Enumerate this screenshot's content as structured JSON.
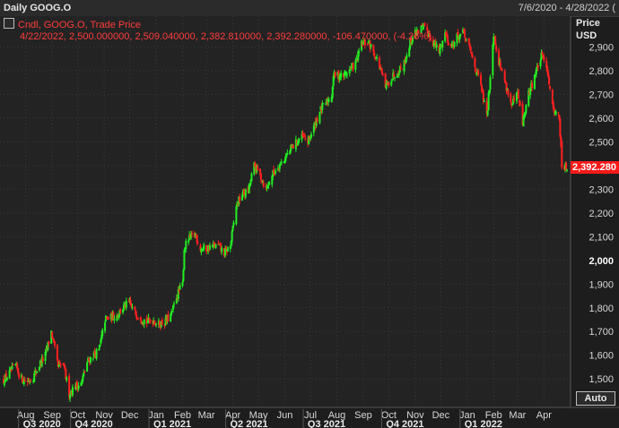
{
  "header": {
    "title": "Daily GOOG.O",
    "range": "7/6/2020 - 4/28/2022 ("
  },
  "legend": {
    "line1": "Cndl, GOOG.O, Trade Price",
    "line2": "4/22/2022, 2,500.000000, 2,509.040000, 2,382.810000, 2,392.280000, -106.470000, (-4.26%)"
  },
  "axis_head": {
    "line1": "Price",
    "line2": "USD"
  },
  "last_price_label": "2,392.280",
  "auto_button": "Auto",
  "colors": {
    "up": "#22ee22",
    "down": "#ff2020",
    "grid": "#3a3a3a",
    "background": "#232323"
  },
  "chart_data": {
    "type": "candlestick",
    "title": "Daily GOOG.O",
    "ylabel": "Price USD",
    "ylim": [
      1380,
      3030
    ],
    "grid": true,
    "y_ticks": [
      1500,
      1600,
      1700,
      1800,
      1900,
      2000,
      2100,
      2200,
      2300,
      2400,
      2500,
      2600,
      2700,
      2800,
      2900
    ],
    "y_tick_labels": [
      "1,500",
      "1,600",
      "1,700",
      "1,800",
      "1,900",
      "2,000",
      "2,100",
      "2,200",
      "2,300",
      "2,400",
      "2,500",
      "2,600",
      "2,700",
      "2,800",
      "2,900"
    ],
    "x_ticks": [
      {
        "label": "Aug",
        "date": "2020-08-01"
      },
      {
        "label": "Sep",
        "date": "2020-09-01"
      },
      {
        "label": "Oct",
        "date": "2020-10-01"
      },
      {
        "label": "Nov",
        "date": "2020-11-01"
      },
      {
        "label": "Dec",
        "date": "2020-12-01"
      },
      {
        "label": "Jan",
        "date": "2021-01-01"
      },
      {
        "label": "Feb",
        "date": "2021-02-01"
      },
      {
        "label": "Mar",
        "date": "2021-03-01"
      },
      {
        "label": "Apr",
        "date": "2021-04-01"
      },
      {
        "label": "May",
        "date": "2021-05-01"
      },
      {
        "label": "Jun",
        "date": "2021-06-01"
      },
      {
        "label": "Jul",
        "date": "2021-07-01"
      },
      {
        "label": "Aug",
        "date": "2021-08-01"
      },
      {
        "label": "Sep",
        "date": "2021-09-01"
      },
      {
        "label": "Oct",
        "date": "2021-10-01"
      },
      {
        "label": "Nov",
        "date": "2021-11-01"
      },
      {
        "label": "Dec",
        "date": "2021-12-01"
      },
      {
        "label": "Jan",
        "date": "2022-01-01"
      },
      {
        "label": "Feb",
        "date": "2022-02-01"
      },
      {
        "label": "Mar",
        "date": "2022-03-01"
      },
      {
        "label": "Apr",
        "date": "2022-04-01"
      }
    ],
    "x_groups": [
      {
        "label": "Q3 2020",
        "date": "2020-08-01"
      },
      {
        "label": "Q4 2020",
        "date": "2020-10-01"
      },
      {
        "label": "Q1 2021",
        "date": "2021-01-01"
      },
      {
        "label": "Q2 2021",
        "date": "2021-04-01"
      },
      {
        "label": "Q3 2021",
        "date": "2021-07-01"
      },
      {
        "label": "Q4 2021",
        "date": "2021-10-01"
      },
      {
        "label": "Q1 2022",
        "date": "2022-01-01"
      }
    ],
    "x_range": [
      "2020-07-06",
      "2022-04-28"
    ],
    "close_path": [
      [
        "2020-07-06",
        1495
      ],
      [
        "2020-07-13",
        1525
      ],
      [
        "2020-07-20",
        1555
      ],
      [
        "2020-07-27",
        1500
      ],
      [
        "2020-08-03",
        1490
      ],
      [
        "2020-08-10",
        1510
      ],
      [
        "2020-08-17",
        1560
      ],
      [
        "2020-08-24",
        1600
      ],
      [
        "2020-08-31",
        1700
      ],
      [
        "2020-09-03",
        1640
      ],
      [
        "2020-09-08",
        1550
      ],
      [
        "2020-09-14",
        1560
      ],
      [
        "2020-09-21",
        1440
      ],
      [
        "2020-09-28",
        1470
      ],
      [
        "2020-10-05",
        1480
      ],
      [
        "2020-10-12",
        1570
      ],
      [
        "2020-10-19",
        1600
      ],
      [
        "2020-10-26",
        1620
      ],
      [
        "2020-11-02",
        1750
      ],
      [
        "2020-11-09",
        1760
      ],
      [
        "2020-11-16",
        1770
      ],
      [
        "2020-11-23",
        1800
      ],
      [
        "2020-11-30",
        1820
      ],
      [
        "2020-12-07",
        1780
      ],
      [
        "2020-12-14",
        1760
      ],
      [
        "2020-12-21",
        1740
      ],
      [
        "2020-12-28",
        1750
      ],
      [
        "2021-01-04",
        1730
      ],
      [
        "2021-01-11",
        1740
      ],
      [
        "2021-01-19",
        1770
      ],
      [
        "2021-01-25",
        1850
      ],
      [
        "2021-02-01",
        1900
      ],
      [
        "2021-02-03",
        2050
      ],
      [
        "2021-02-08",
        2090
      ],
      [
        "2021-02-16",
        2110
      ],
      [
        "2021-02-22",
        2050
      ],
      [
        "2021-03-01",
        2050
      ],
      [
        "2021-03-08",
        2060
      ],
      [
        "2021-03-15",
        2060
      ],
      [
        "2021-03-22",
        2030
      ],
      [
        "2021-03-29",
        2060
      ],
      [
        "2021-04-05",
        2230
      ],
      [
        "2021-04-12",
        2280
      ],
      [
        "2021-04-19",
        2290
      ],
      [
        "2021-04-26",
        2400
      ],
      [
        "2021-05-03",
        2360
      ],
      [
        "2021-05-10",
        2300
      ],
      [
        "2021-05-17",
        2360
      ],
      [
        "2021-05-24",
        2400
      ],
      [
        "2021-06-01",
        2430
      ],
      [
        "2021-06-08",
        2470
      ],
      [
        "2021-06-15",
        2500
      ],
      [
        "2021-06-22",
        2520
      ],
      [
        "2021-06-28",
        2500
      ],
      [
        "2021-07-06",
        2570
      ],
      [
        "2021-07-12",
        2630
      ],
      [
        "2021-07-19",
        2660
      ],
      [
        "2021-07-26",
        2700
      ],
      [
        "2021-07-28",
        2780
      ],
      [
        "2021-08-09",
        2780
      ],
      [
        "2021-08-23",
        2830
      ],
      [
        "2021-08-30",
        2910
      ],
      [
        "2021-09-07",
        2920
      ],
      [
        "2021-09-13",
        2880
      ],
      [
        "2021-09-20",
        2820
      ],
      [
        "2021-09-27",
        2730
      ],
      [
        "2021-10-04",
        2770
      ],
      [
        "2021-10-11",
        2800
      ],
      [
        "2021-10-18",
        2820
      ],
      [
        "2021-10-26",
        2920
      ],
      [
        "2021-11-01",
        2960
      ],
      [
        "2021-11-08",
        2980
      ],
      [
        "2021-11-15",
        2970
      ],
      [
        "2021-11-22",
        2920
      ],
      [
        "2021-11-29",
        2880
      ],
      [
        "2021-12-06",
        2960
      ],
      [
        "2021-12-13",
        2900
      ],
      [
        "2021-12-20",
        2940
      ],
      [
        "2021-12-27",
        2960
      ],
      [
        "2022-01-03",
        2900
      ],
      [
        "2022-01-10",
        2820
      ],
      [
        "2022-01-18",
        2720
      ],
      [
        "2022-01-24",
        2600
      ],
      [
        "2022-02-01",
        2960
      ],
      [
        "2022-02-07",
        2840
      ],
      [
        "2022-02-14",
        2760
      ],
      [
        "2022-02-22",
        2650
      ],
      [
        "2022-03-01",
        2700
      ],
      [
        "2022-03-07",
        2580
      ],
      [
        "2022-03-14",
        2700
      ],
      [
        "2022-03-21",
        2780
      ],
      [
        "2022-03-29",
        2860
      ],
      [
        "2022-04-04",
        2830
      ],
      [
        "2022-04-11",
        2650
      ],
      [
        "2022-04-19",
        2600
      ],
      [
        "2022-04-22",
        2392.28
      ],
      [
        "2022-04-28",
        2390
      ]
    ],
    "last": {
      "date": "2022-04-22",
      "open": 2500.0,
      "high": 2509.04,
      "low": 2382.81,
      "close": 2392.28,
      "change": -106.47,
      "change_pct": "-4.26%"
    }
  }
}
